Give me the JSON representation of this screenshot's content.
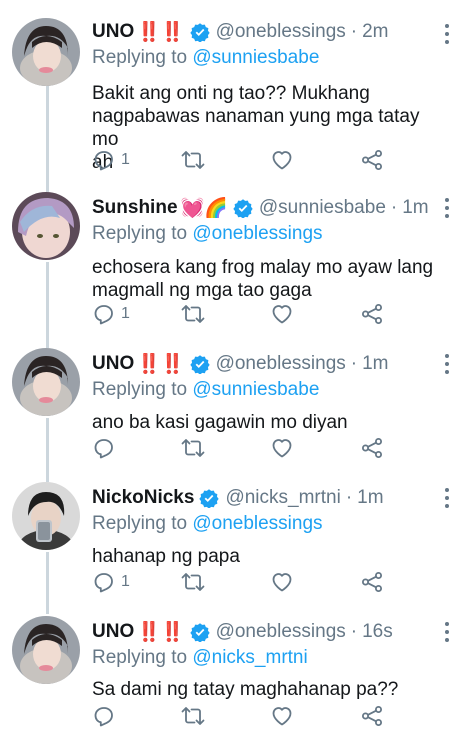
{
  "tweets": [
    {
      "name": "UNO",
      "emoji": "‼️‼️",
      "handle": "@oneblessings",
      "dot": "·",
      "time": "2m",
      "replying_prefix": "Replying to",
      "replying_to": "@sunniesbabe",
      "text_lines": [
        "Bakit ang onti ng tao?? Mukhang",
        "nagpabawas nanaman yung mga tatay mo",
        "ah"
      ],
      "reply_count": "1"
    },
    {
      "name": "Sunshine",
      "emoji": "💓🌈",
      "handle": "@sunniesbabe",
      "dot": "·",
      "time": "1m",
      "replying_prefix": "Replying to",
      "replying_to": "@oneblessings",
      "text_lines": [
        "echosera kang frog malay mo ayaw lang",
        "magmall ng mga tao gaga"
      ],
      "reply_count": "1"
    },
    {
      "name": "UNO",
      "emoji": "‼️‼️",
      "handle": "@oneblessings",
      "dot": "·",
      "time": "1m",
      "replying_prefix": "Replying to",
      "replying_to": "@sunniesbabe",
      "text_lines": [
        "ano ba kasi gagawin mo diyan"
      ],
      "reply_count": ""
    },
    {
      "name": "NickoNicks",
      "emoji": "",
      "handle": "@nicks_mrtni",
      "dot": "·",
      "time": "1m",
      "replying_prefix": "Replying to",
      "replying_to": "@oneblessings",
      "text_lines": [
        "hahanap ng papa"
      ],
      "reply_count": "1"
    },
    {
      "name": "UNO",
      "emoji": "‼️‼️",
      "handle": "@oneblessings",
      "dot": "·",
      "time": "16s",
      "replying_prefix": "Replying to",
      "replying_to": "@nicks_mrtni",
      "text_lines": [
        "Sa dami ng tatay maghahanap pa??"
      ],
      "reply_count": ""
    }
  ],
  "icons": {
    "reply": "reply-icon",
    "retweet": "retweet-icon",
    "like": "heart-icon",
    "share": "share-icon",
    "verified": "verified-badge-icon",
    "more": "more-options-icon"
  },
  "colors": {
    "link": "#1da1f2",
    "secondary_text": "#657786",
    "verified": "#1da1f2",
    "thread_line": "#ccd6dd"
  }
}
